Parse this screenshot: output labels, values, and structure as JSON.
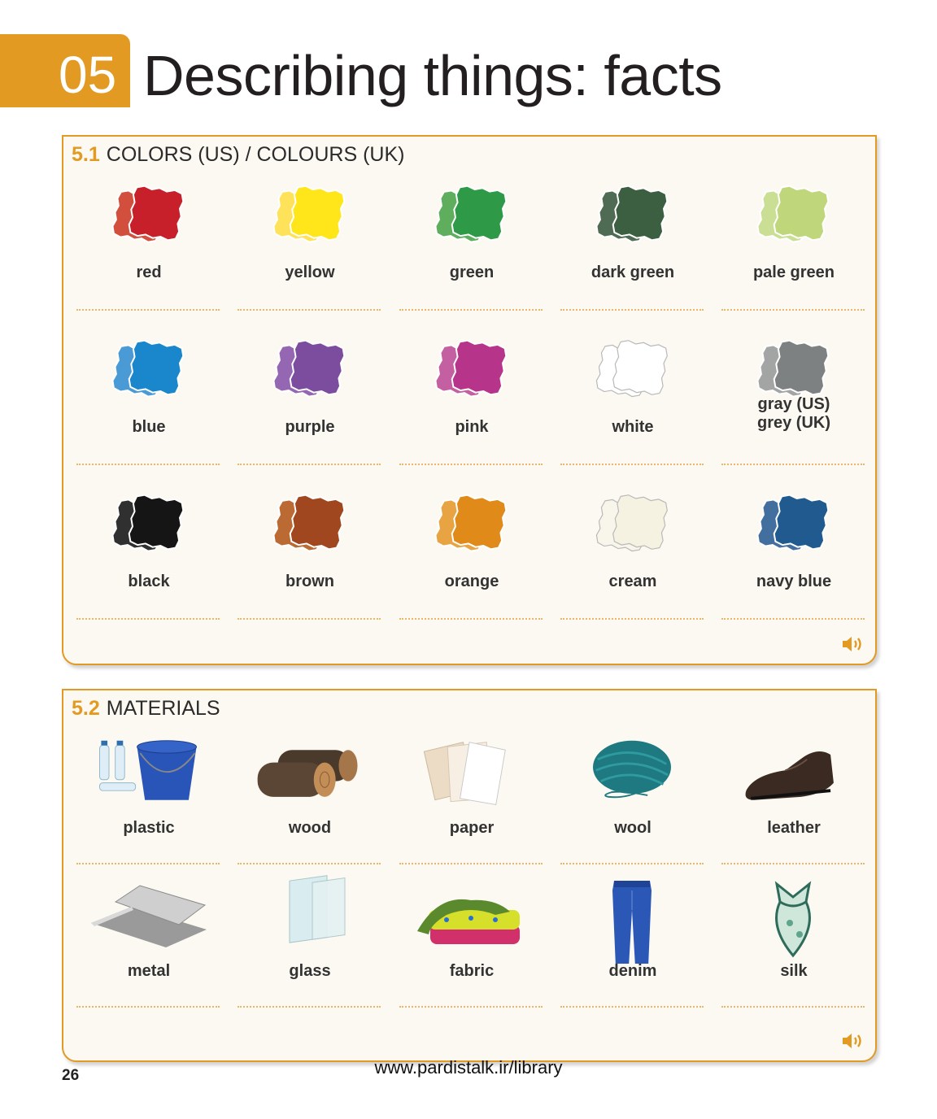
{
  "header": {
    "chapter_number": "05",
    "title": "Describing things: facts"
  },
  "colors_section": {
    "number": "5.1",
    "title": "COLORS (US) / COLOURS (UK)",
    "items": [
      {
        "label": "red",
        "color": "#c8202a",
        "back": "#d24f3e"
      },
      {
        "label": "yellow",
        "color": "#ffe61a",
        "back": "#fee35a"
      },
      {
        "label": "green",
        "color": "#2e9a48",
        "back": "#5fae5d"
      },
      {
        "label": "dark green",
        "color": "#3d5f41",
        "back": "#506b53"
      },
      {
        "label": "pale green",
        "color": "#bfd77a",
        "back": "#cadf94"
      },
      {
        "label": "blue",
        "color": "#1a87cc",
        "back": "#4a9ad6"
      },
      {
        "label": "purple",
        "color": "#7c4d9e",
        "back": "#9566b1"
      },
      {
        "label": "pink",
        "color": "#b6358a",
        "back": "#c45fa1"
      },
      {
        "label": "white",
        "color": "#ffffff",
        "back": "#ffffff",
        "outline": "#b9b9b9"
      },
      {
        "label": "gray (US)\ngrey (UK)",
        "color": "#7e8181",
        "back": "#a3a5a5"
      },
      {
        "label": "black",
        "color": "#151515",
        "back": "#303030"
      },
      {
        "label": "brown",
        "color": "#a0471f",
        "back": "#bb6a33"
      },
      {
        "label": "orange",
        "color": "#e08a1a",
        "back": "#e8a443"
      },
      {
        "label": "cream",
        "color": "#f6f2e2",
        "back": "#f8f5ea",
        "outline": "#b9b9b9"
      },
      {
        "label": "navy blue",
        "color": "#215a8f",
        "back": "#436f9f"
      }
    ]
  },
  "materials_section": {
    "number": "5.2",
    "title": "MATERIALS",
    "items": [
      {
        "label": "plastic",
        "icon": "plastic-icon"
      },
      {
        "label": "wood",
        "icon": "wood-icon"
      },
      {
        "label": "paper",
        "icon": "paper-icon"
      },
      {
        "label": "wool",
        "icon": "wool-icon"
      },
      {
        "label": "leather",
        "icon": "leather-shoe-icon"
      },
      {
        "label": "metal",
        "icon": "metal-icon"
      },
      {
        "label": "glass",
        "icon": "glass-icon"
      },
      {
        "label": "fabric",
        "icon": "fabric-icon"
      },
      {
        "label": "denim",
        "icon": "denim-icon"
      },
      {
        "label": "silk",
        "icon": "silk-icon"
      }
    ]
  },
  "audio_icon": "speaker-icon",
  "footer": {
    "page_number": "26",
    "url": "www.pardistalk.ir/library"
  }
}
